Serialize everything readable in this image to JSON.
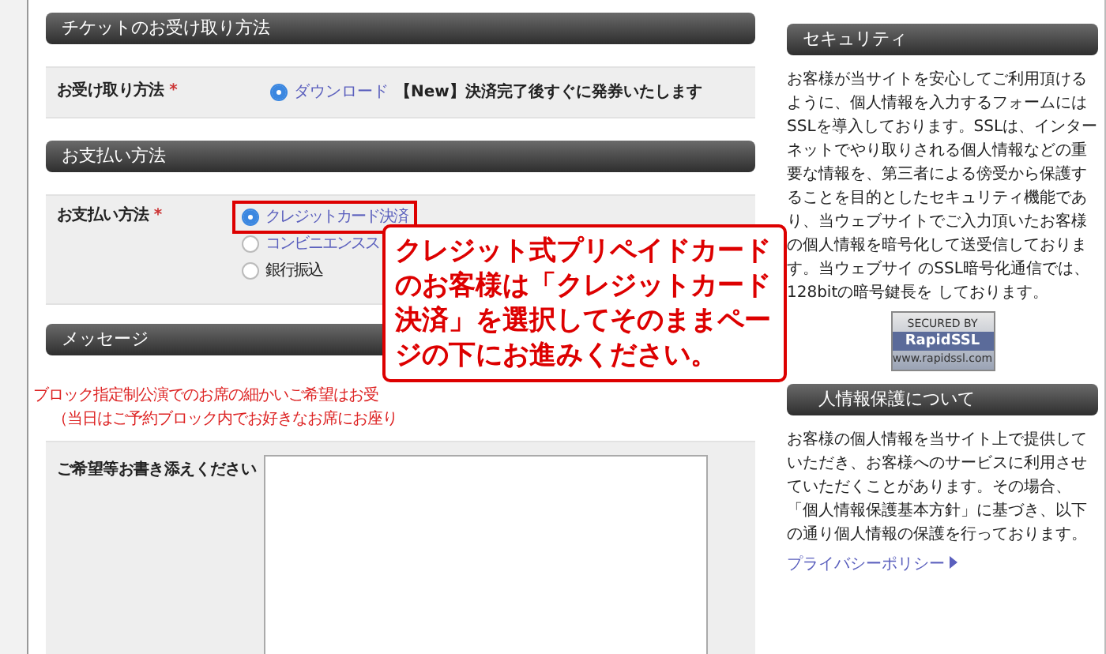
{
  "receipt_section": {
    "title": "チケットのお受け取り方法",
    "field_label": "お受け取り方法",
    "required_mark": "*",
    "options": [
      {
        "label": "ダウンロード",
        "note": "【New】決済完了後すぐに発券いたします",
        "selected": true,
        "link": true,
        "highlighted": false
      }
    ]
  },
  "payment_section": {
    "title": "お支払い方法",
    "field_label": "お支払い方法",
    "required_mark": "*",
    "options": [
      {
        "label": "クレジットカード決済",
        "selected": true,
        "link": true,
        "highlighted": true
      },
      {
        "label": "コンビニエンスス",
        "selected": false,
        "link": true,
        "highlighted": false
      },
      {
        "label": "銀行振込",
        "selected": false,
        "link": false,
        "highlighted": false
      }
    ]
  },
  "message_section": {
    "title": "メッセージ",
    "notice_lines": [
      "ブロック指定制公演でのお席の細かいご希望はお受",
      "（当日はご予約ブロック内でお好きなお席にお座り"
    ],
    "field_label": "ご希望等お書き添えください"
  },
  "callout": {
    "text": "クレジット式プリペイドカードのお客様は「クレジットカード決済」を選択してそのままページの下にお進みください。"
  },
  "sidebar": {
    "security": {
      "title": "セキュリティ",
      "text": "お客様が当サイトを安心してご利用頂けるように、個人情報を入力するフォームにはSSLを導入しております。SSLは、インターネットでやり取りされる個人情報などの重要な情報を、第三者による傍受から保護することを目的としたセキュリティ機能であり、当ウェブサイトでご入力頂いたお客様の個人情報を暗号化して送受信しております。当ウェブサイ のSSL暗号化通信では、128bitの暗号鍵長を しております。",
      "badge": {
        "top": "SECURED BY",
        "brand": "RapidSSL",
        "url": "www.rapidssl.com"
      }
    },
    "privacy": {
      "title": "人情報保護について",
      "text": "お客様の個人情報を当サイト上で提供していただき、お客様へのサービスに利用させていただくことがあります。その場合、「個人情報保護基本方針」に基づき、以下の通り個人情報の保護を行っております。",
      "link": "プライバシーポリシー"
    }
  }
}
